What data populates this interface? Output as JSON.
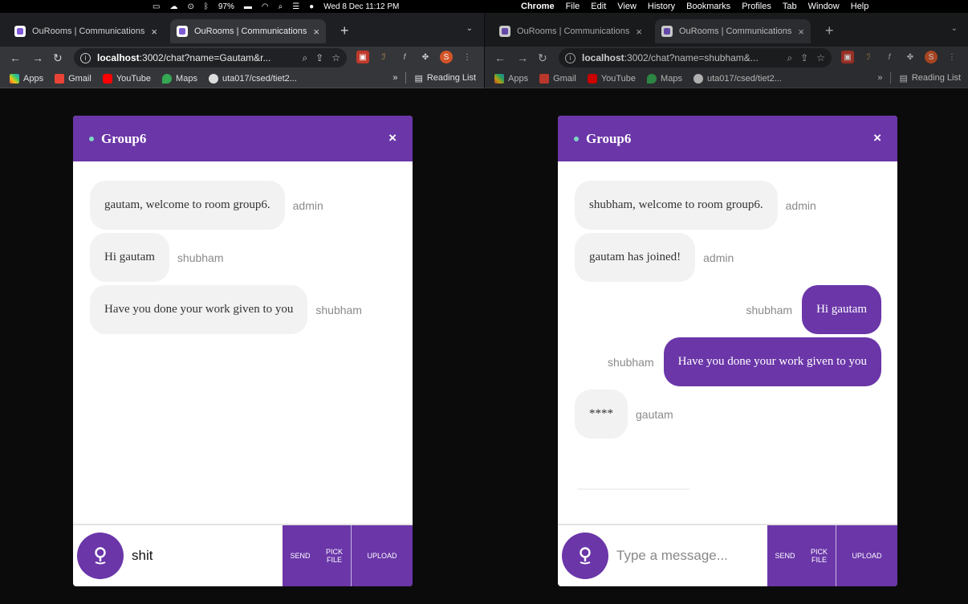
{
  "menubar": {
    "battery": "97%",
    "datetime": "Wed 8 Dec  11:12 PM",
    "apple": "",
    "menus": [
      "Chrome",
      "File",
      "Edit",
      "View",
      "History",
      "Bookmarks",
      "Profiles",
      "Tab",
      "Window",
      "Help"
    ]
  },
  "browser": {
    "tab_title": "OuRooms | Communications",
    "bookmarks": [
      "Apps",
      "Gmail",
      "YouTube",
      "Maps",
      "uta017/csed/tiet2..."
    ],
    "reading_list": "Reading List",
    "more_bookmarks": "»",
    "extension_avatar": "S"
  },
  "left": {
    "url_host": "localhost",
    "url_rest": ":3002/chat?name=Gautam&r...",
    "chat": {
      "title": "Group6",
      "close": "×",
      "messages": [
        {
          "text": "gautam, welcome to room group6.",
          "sender": "admin"
        },
        {
          "text": "Hi gautam",
          "sender": "shubham"
        },
        {
          "text": "Have you done your work given to you",
          "sender": "shubham"
        }
      ],
      "input_value": "shit",
      "input_placeholder": "Type a message...",
      "send": "Send",
      "pick_file": "Pick File",
      "upload": "Upload"
    }
  },
  "right": {
    "url_host": "localhost",
    "url_rest": ":3002/chat?name=shubham&...",
    "chat": {
      "title": "Group6",
      "close": "×",
      "messages": [
        {
          "text": "shubham, welcome to room group6.",
          "sender": "admin",
          "out": false
        },
        {
          "text": "gautam has joined!",
          "sender": "admin",
          "out": false
        },
        {
          "text": "Hi gautam",
          "sender": "shubham",
          "out": true
        },
        {
          "text": "Have you done your work given to you",
          "sender": "shubham",
          "out": true
        },
        {
          "text": "****",
          "sender": "gautam",
          "out": false
        }
      ],
      "input_value": "",
      "input_placeholder": "Type a message...",
      "send": "Send",
      "pick_file": "Pick File",
      "upload": "Upload"
    }
  },
  "colors": {
    "accent": "#6a36a8",
    "bubble_in": "#f2f2f2",
    "online": "#7fd7c4"
  }
}
